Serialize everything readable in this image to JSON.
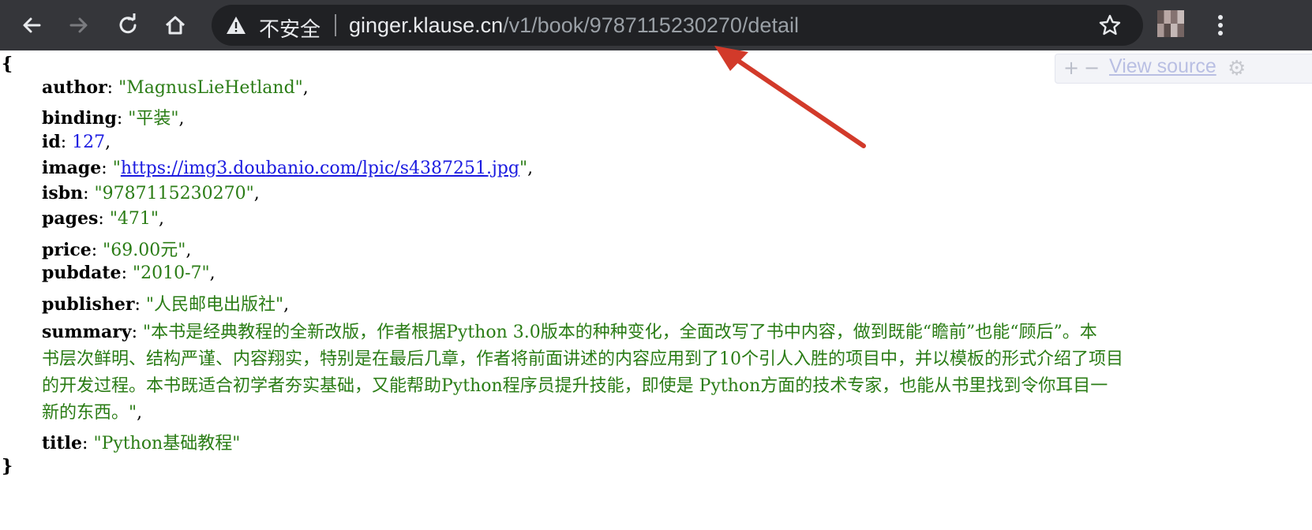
{
  "browser": {
    "security_label": "不安全",
    "url_host": "ginger.klause.cn",
    "url_path": "/v1/book/9787115230270/detail"
  },
  "viewer": {
    "plus": "+",
    "minus": "−",
    "view_source": "View source"
  },
  "json": {
    "open_brace": "{",
    "close_brace": "}",
    "author_key": "author",
    "author_value": "\"MagnusLieHetland\"",
    "binding_key": "binding",
    "binding_value": "\"平装\"",
    "id_key": "id",
    "id_value": "127",
    "image_key": "image",
    "image_value": "https://img3.doubanio.com/lpic/s4387251.jpg",
    "isbn_key": "isbn",
    "isbn_value": "\"9787115230270\"",
    "pages_key": "pages",
    "pages_value": "\"471\"",
    "price_key": "price",
    "price_value": "\"69.00元\"",
    "pubdate_key": "pubdate",
    "pubdate_value": "\"2010-7\"",
    "publisher_key": "publisher",
    "publisher_value": "\"人民邮电出版社\"",
    "summary_key": "summary",
    "summary_lines": [
      "\"本书是经典教程的全新改版，作者根据Python 3.0版本的种种变化，全面改写了书中内容，做到既能“瞻前”也能“顾后”。本",
      "书层次鲜明、结构严谨、内容翔实，特别是在最后几章，作者将前面讲述的内容应用到了10个引人入胜的项目中，并以模板的形式介绍了项目",
      "的开发过程。本书既适合初学者夯实基础，又能帮助Python程序员提升技能，即使是 Python方面的技术专家，也能从书里找到令你耳目一",
      "新的东西。\""
    ],
    "title_key": "title",
    "title_value": "\"Python基础教程\""
  },
  "colors": {
    "toolbar_bg": "#35363a",
    "omnibox_bg": "#202124",
    "json_string": "#2a7c15",
    "json_number": "#1a1ae0",
    "annotation_arrow": "#d23a2a"
  }
}
